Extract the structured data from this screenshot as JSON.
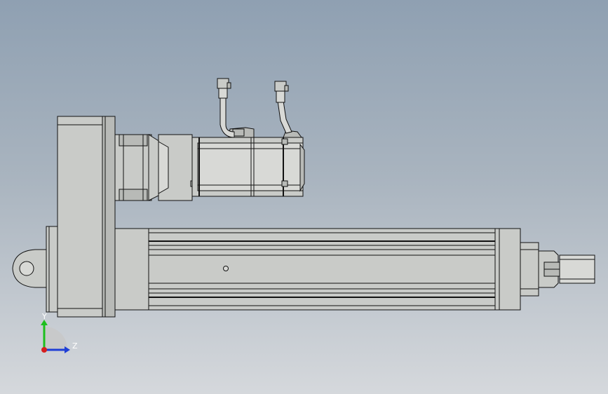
{
  "triad": {
    "y_label": "Y",
    "z_label": "Z",
    "colors": {
      "y_axis": "#1dbf1d",
      "z_axis": "#1f3fd6",
      "x_axis": "#d61f1f"
    }
  },
  "colors": {
    "background_top": "#8fa0b2",
    "background_bottom": "#d5d8dc",
    "part_fill": "#c9cbc8",
    "edge": "#111111"
  }
}
